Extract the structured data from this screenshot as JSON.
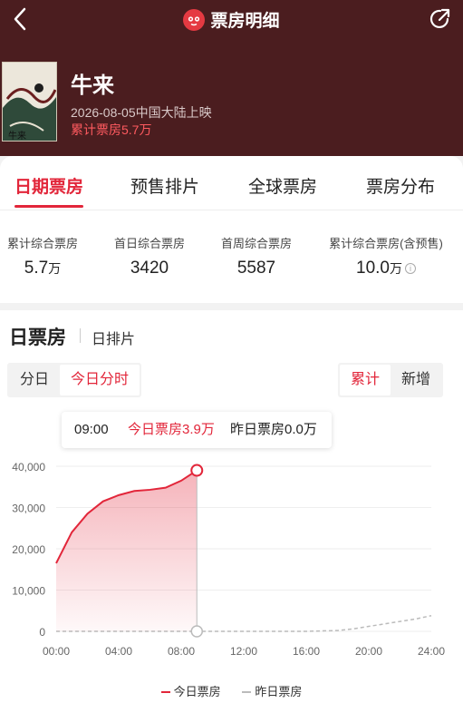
{
  "nav": {
    "title": "票房明细"
  },
  "movie": {
    "title": "牛来",
    "release": "2026-08-05中国大陆上映",
    "total_label": "累计票房5.7万"
  },
  "tabs": [
    {
      "label": "日期票房",
      "active": true
    },
    {
      "label": "预售排片",
      "active": false
    },
    {
      "label": "全球票房",
      "active": false
    },
    {
      "label": "票房分布",
      "active": false
    }
  ],
  "stats": [
    {
      "label": "累计综合票房",
      "value": "5.7",
      "unit": "万"
    },
    {
      "label": "首日综合票房",
      "value": "3420",
      "unit": ""
    },
    {
      "label": "首周综合票房",
      "value": "5587",
      "unit": ""
    },
    {
      "label": "累计综合票房(含预售)",
      "value": "10.0",
      "unit": "万"
    }
  ],
  "section": {
    "title": "日票房",
    "subtitle": "日排片"
  },
  "view_toggle": {
    "options": [
      "分日",
      "今日分时"
    ],
    "selected": "今日分时"
  },
  "mode_toggle": {
    "options": [
      "累计",
      "新增"
    ],
    "selected": "累计"
  },
  "tooltip": {
    "time": "09:00",
    "today": "今日票房3.9万",
    "yesterday": "昨日票房0.0万"
  },
  "colors": {
    "accent": "#e2263a",
    "header_bg": "#4b1d1f",
    "yesterday_line": "#bbbbbb"
  },
  "chart_data": {
    "type": "area",
    "title": "",
    "xlabel": "",
    "ylabel": "",
    "x_ticks": [
      "00:00",
      "04:00",
      "08:00",
      "12:00",
      "16:00",
      "20:00",
      "24:00"
    ],
    "y_ticks": [
      "0",
      "10,000",
      "20,000",
      "30,000",
      "40,000"
    ],
    "ylim": [
      0,
      40000
    ],
    "xlim_hours": [
      0,
      24
    ],
    "grid": true,
    "legend_position": "bottom-center",
    "series": [
      {
        "name": "今日票房",
        "style": "solid-area",
        "x": [
          0,
          1,
          2,
          3,
          4,
          5,
          6,
          7,
          8,
          9
        ],
        "y": [
          16500,
          24000,
          28500,
          31500,
          33000,
          34000,
          34300,
          34800,
          36500,
          39000
        ]
      },
      {
        "name": "昨日票房",
        "style": "dashed",
        "x": [
          0,
          4,
          8,
          12,
          16,
          18,
          19,
          20,
          21,
          22,
          23,
          24
        ],
        "y": [
          0,
          0,
          0,
          0,
          0,
          200,
          600,
          1200,
          1800,
          2400,
          3000,
          3800
        ]
      }
    ]
  }
}
